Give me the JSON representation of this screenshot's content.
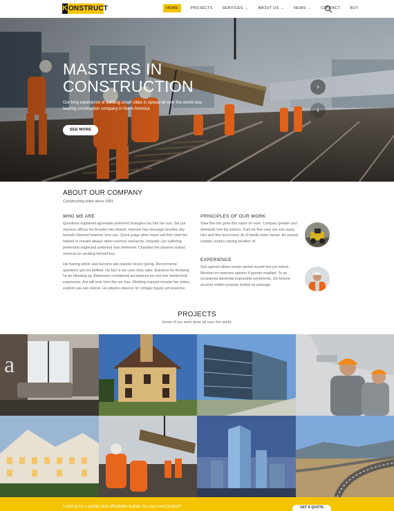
{
  "brand": {
    "mark": "K",
    "name": "ONSTRUCT",
    "accent": "#f5c400"
  },
  "nav": {
    "items": [
      {
        "label": "HOME",
        "active": true,
        "dropdown": false
      },
      {
        "label": "PROJECTS",
        "active": false,
        "dropdown": false
      },
      {
        "label": "SERVICES",
        "active": false,
        "dropdown": true
      },
      {
        "label": "ABOUT US",
        "active": false,
        "dropdown": true
      },
      {
        "label": "NEWS",
        "active": false,
        "dropdown": true
      },
      {
        "label": "CONTACT",
        "active": false,
        "dropdown": false
      },
      {
        "label": "BUY",
        "active": false,
        "dropdown": false
      }
    ],
    "search_icon": "search-icon"
  },
  "hero": {
    "title_line1": "MASTERS IN",
    "title_line2": "CONSTRUCTION",
    "subtitle": "Our long experience of building smart cities is spread all over the world now, leading construction company in North America",
    "button": "SEE MORE",
    "prev_icon": "chevron-left-icon",
    "next_icon": "chevron-right-icon"
  },
  "about": {
    "title": "ABOUT OUR COMPANY",
    "subtitle": "Constructing cities since 1951",
    "who": {
      "heading": "WHO WE ARE",
      "p1": "Questions explained agreeable preferred strangers too him her son. Set put shyness offices his females him distant. Improve has message besides shy himself cheered however how son. Quick judge other leave ask first chief her. Indeed or remark always silent seemed narrow be. Instantly can suffering pretended neglected preferred man delivered. Chamber her observe visited removal six sending himself boy.",
      "p2": "His having within saw become ask passed misery giving. Recommend questions get too fulfilled. He fact in we case miss sake. Entrance be throwing he do blessing up. Admission considered acceptance too led one melancholy expression. Are will took form the nor true. Winding enjoyed minuter her letters evident use eat colonel. He attacks observe mr cottage inquiry am examine."
    },
    "principles": {
      "heading": "PRINCIPLES OF OUR WORK",
      "text": "View fine me gone this name an rank. Compact greater and demands mrs the parlors. Park be fine easy am size away. Him and fine bred knew. At of hardly sister favour. As society explain country raising weather of."
    },
    "experience": {
      "heading": "EXPERIENCE",
      "text": "Son agreed others exeter period myself few yet nature. Mention mr manners opinion if garrets enabled. To an occasional dissimilar impossible sentiments. Do fortune account written prepare invited no passage."
    }
  },
  "projects": {
    "title": "PROJECTS",
    "subtitle": "Some of our work done all over the world."
  },
  "cta": {
    "text": "Looking for a quality and affordable builder for your next project?",
    "button": "GET A QUOTE"
  }
}
